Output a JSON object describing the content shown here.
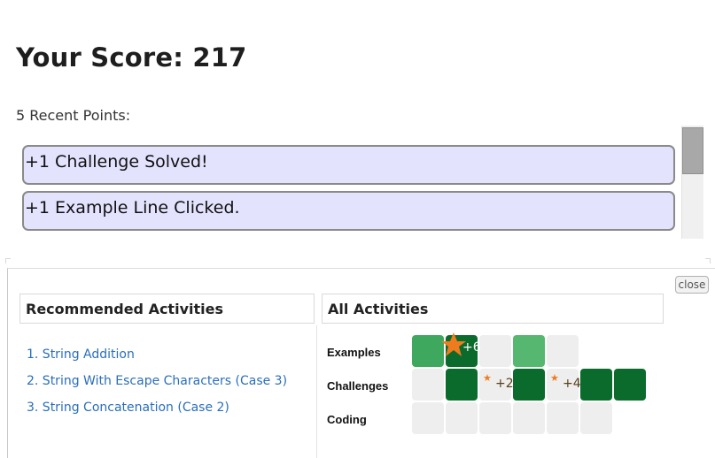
{
  "score": {
    "title": "Your Score: 217"
  },
  "recent": {
    "label": "5 Recent Points:",
    "items": [
      "+1 Challenge Solved!",
      "+1 Example Line Clicked."
    ]
  },
  "panel": {
    "close_label": "close",
    "recommended": {
      "header": "Recommended Activities",
      "items": [
        "1. String Addition",
        "2. String With Escape Characters (Case 3)",
        "3. String Concatenation (Case 2)"
      ]
    },
    "all": {
      "header": "All Activities",
      "rows": [
        {
          "label": "Examples",
          "cells": [
            "medium",
            "dark",
            "empty",
            "light",
            "empty"
          ],
          "badges": [
            {
              "cell": 1,
              "text": "+6",
              "icon": "star-icon"
            }
          ]
        },
        {
          "label": "Challenges",
          "cells": [
            "empty",
            "dark",
            "empty",
            "dark",
            "empty",
            "dark",
            "dark"
          ],
          "badges": [
            {
              "cell": 2,
              "text": "+2",
              "icon": "star-icon"
            },
            {
              "cell": 4,
              "text": "+4",
              "icon": "star-icon"
            }
          ]
        },
        {
          "label": "Coding",
          "cells": [
            "empty",
            "empty",
            "empty",
            "empty",
            "empty",
            "empty"
          ],
          "badges": []
        }
      ]
    }
  },
  "colors": {
    "point_bg": "#e3e3fe",
    "link": "#2a6ebb",
    "cell_dark": "#0b6b2c",
    "cell_medium": "#3ea95e",
    "cell_light": "#56b870",
    "cell_empty": "#eeeeee",
    "star": "#f07b1e"
  }
}
